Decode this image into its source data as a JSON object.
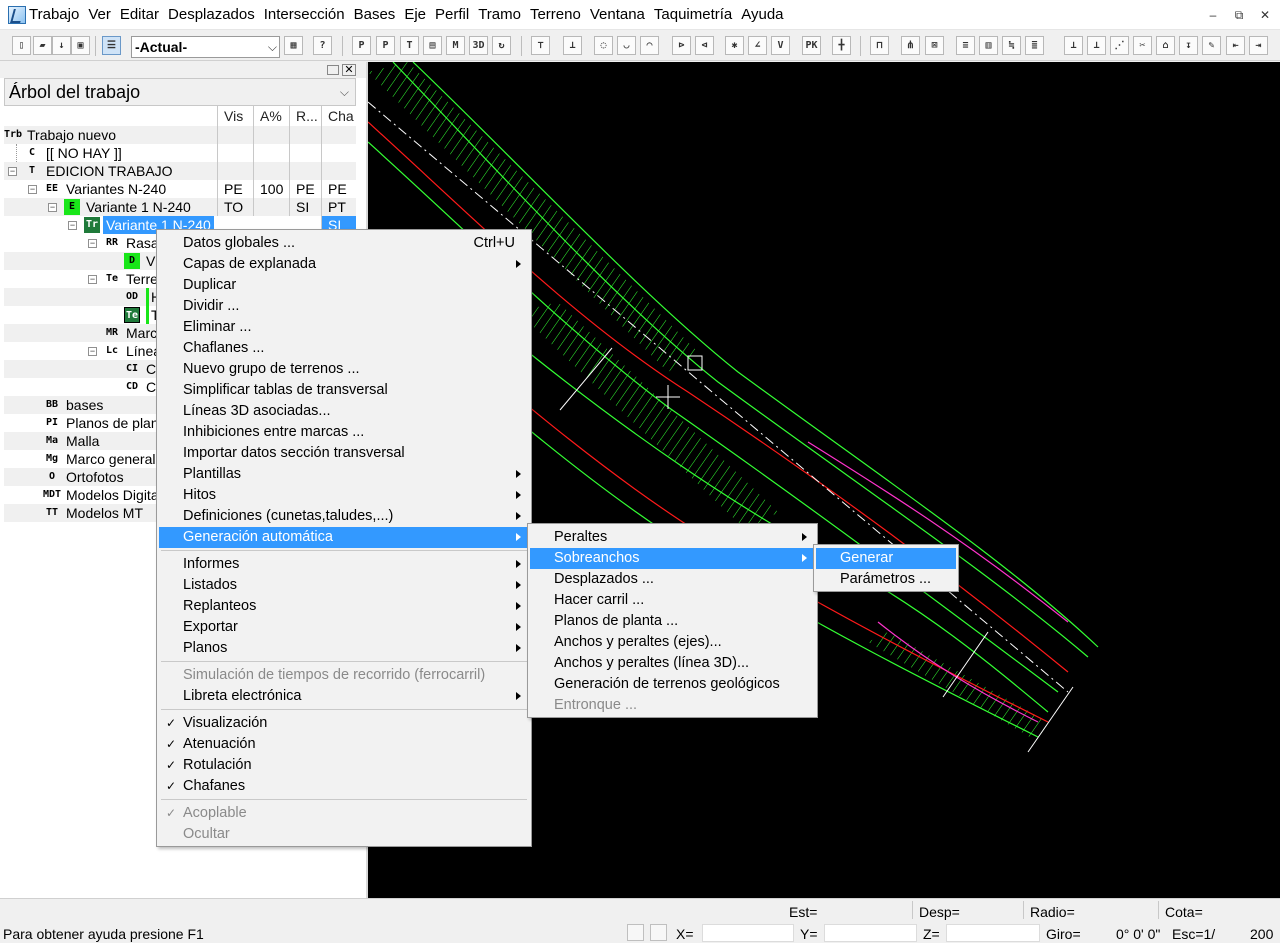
{
  "menubar": {
    "items": [
      "Trabajo",
      "Ver",
      "Editar",
      "Desplazados",
      "Intersección",
      "Bases",
      "Eje",
      "Perfil",
      "Tramo",
      "Terreno",
      "Ventana",
      "Taquimetría",
      "Ayuda"
    ],
    "minimize": "–",
    "restore": "⧉",
    "close": "✕"
  },
  "toolbar": {
    "combo_value": "-Actual-",
    "combo_arrow": "⌵"
  },
  "tree": {
    "panel_title": "Árbol del trabajo",
    "panel_title_arrow": "⌵",
    "close": "✕",
    "columns": [
      "Vis",
      "A%",
      "R...",
      "Cha"
    ],
    "rows": [
      {
        "icon": "Trb",
        "label": "Trabajo nuevo",
        "vis": "",
        "a": "",
        "r": "",
        "cha": ""
      },
      {
        "icon": "C",
        "label": "[[ NO HAY ]]"
      },
      {
        "icon": "T",
        "label": "EDICION TRABAJO"
      },
      {
        "icon": "EE",
        "label": "Variantes N-240",
        "vis": "PE",
        "a": "100",
        "r": "PE",
        "cha": "PE"
      },
      {
        "icon": "E",
        "label": "Variante 1 N-240",
        "vis": "TO",
        "a": "",
        "r": "SI",
        "cha": "PT"
      },
      {
        "icon": "Tr",
        "label": "Variante 1 N-240",
        "vis": "",
        "a": "",
        "r": "",
        "cha": "SI"
      },
      {
        "icon": "RR",
        "label": "Rasa"
      },
      {
        "icon": "D",
        "label": "V"
      },
      {
        "icon": "Te",
        "label": "Terre"
      },
      {
        "icon": "OD",
        "label": "H"
      },
      {
        "icon": "Te",
        "label": "T"
      },
      {
        "icon": "MR",
        "label": "Marc"
      },
      {
        "icon": "Lc",
        "label": "Línea"
      },
      {
        "icon": "CI",
        "label": "C"
      },
      {
        "icon": "CD",
        "label": "C"
      },
      {
        "icon": "BB",
        "label": "bases"
      },
      {
        "icon": "PI",
        "label": "Planos de plan"
      },
      {
        "icon": "Ma",
        "label": "Malla"
      },
      {
        "icon": "Mg",
        "label": "Marco general"
      },
      {
        "icon": "O",
        "label": "Ortofotos"
      },
      {
        "icon": "MDT",
        "label": "Modelos Digita"
      },
      {
        "icon": "TT",
        "label": "Modelos MT"
      }
    ]
  },
  "context_menu": {
    "items": [
      {
        "label": "Datos globales ...",
        "accel": "Ctrl+U"
      },
      {
        "label": "Capas de explanada",
        "submenu": true
      },
      {
        "label": "Duplicar"
      },
      {
        "label": "Dividir ..."
      },
      {
        "label": "Eliminar ..."
      },
      {
        "label": "Chaflanes ..."
      },
      {
        "label": "Nuevo grupo de terrenos ..."
      },
      {
        "label": "Simplificar tablas de transversal"
      },
      {
        "label": "Líneas 3D asociadas..."
      },
      {
        "label": "Inhibiciones entre marcas ..."
      },
      {
        "label": "Importar datos sección transversal"
      },
      {
        "label": "Plantillas",
        "submenu": true
      },
      {
        "label": "Hitos",
        "submenu": true
      },
      {
        "label": "Definiciones (cunetas,taludes,...)",
        "submenu": true
      },
      {
        "label": "Generación automática",
        "submenu": true,
        "highlighted": true
      },
      {
        "label": "Informes",
        "submenu": true
      },
      {
        "label": "Listados",
        "submenu": true
      },
      {
        "label": "Replanteos",
        "submenu": true
      },
      {
        "label": "Exportar",
        "submenu": true
      },
      {
        "label": "Planos",
        "submenu": true
      },
      {
        "label": "Simulación de tiempos de recorrido (ferrocarril)",
        "disabled": true
      },
      {
        "label": "Libreta electrónica",
        "submenu": true
      },
      {
        "label": "Visualización",
        "checked": true
      },
      {
        "label": "Atenuación",
        "checked": true
      },
      {
        "label": "Rotulación",
        "checked": true
      },
      {
        "label": "Chafanes",
        "checked": true
      },
      {
        "label": "Acoplable",
        "checked": true,
        "disabled": true
      },
      {
        "label": "Ocultar",
        "disabled": true
      }
    ],
    "check_mark": "✓"
  },
  "submenu_generacion": {
    "items": [
      {
        "label": "Peraltes",
        "submenu": true
      },
      {
        "label": "Sobreanchos",
        "submenu": true,
        "highlighted": true
      },
      {
        "label": "Desplazados ..."
      },
      {
        "label": "Hacer carril ..."
      },
      {
        "label": "Planos de planta ..."
      },
      {
        "label": "Anchos y peraltes (ejes)..."
      },
      {
        "label": "Anchos y peraltes (línea 3D)..."
      },
      {
        "label": "Generación de terrenos geológicos"
      },
      {
        "label": "Entronque ...",
        "disabled": true
      }
    ]
  },
  "submenu_sobreanchos": {
    "items": [
      {
        "label": "Generar",
        "highlighted": true
      },
      {
        "label": "Parámetros ..."
      }
    ]
  },
  "statusbar": {
    "help": "Para obtener ayuda presione F1",
    "est": "Est=",
    "desp": "Desp=",
    "radio": "Radio=",
    "cota": "Cota=",
    "x": "X=",
    "y": "Y=",
    "z": "Z=",
    "giro_label": "Giro=",
    "giro_value": "0° 0' 0\"",
    "esc_label": "Esc=1/",
    "esc_value": "200"
  },
  "colors": {
    "highlight": "#3399ff",
    "canvas_bg": "#000000",
    "road_green": "#33ff33",
    "road_red": "#ff1a1a",
    "road_magenta": "#ff33cc"
  }
}
